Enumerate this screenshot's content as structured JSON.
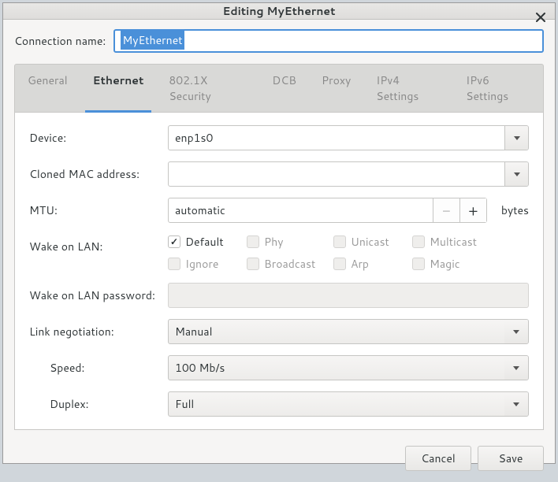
{
  "window": {
    "title": "Editing MyEthernet"
  },
  "connection": {
    "name_label": "Connection name:",
    "name_value": "MyEthernet"
  },
  "tabs": [
    {
      "label": "General"
    },
    {
      "label": "Ethernet"
    },
    {
      "label": "802.1X Security"
    },
    {
      "label": "DCB"
    },
    {
      "label": "Proxy"
    },
    {
      "label": "IPv4 Settings"
    },
    {
      "label": "IPv6 Settings"
    }
  ],
  "active_tab": 1,
  "ethernet": {
    "device_label": "Device:",
    "device_value": "enp1s0",
    "cloned_mac_label": "Cloned MAC address:",
    "cloned_mac_value": "",
    "mtu_label": "MTU:",
    "mtu_value": "automatic",
    "mtu_suffix": "bytes",
    "wol_label": "Wake on LAN:",
    "wol_options": [
      {
        "label": "Default",
        "checked": true,
        "enabled": true
      },
      {
        "label": "Phy",
        "checked": false,
        "enabled": false
      },
      {
        "label": "Unicast",
        "checked": false,
        "enabled": false
      },
      {
        "label": "Multicast",
        "checked": false,
        "enabled": false
      },
      {
        "label": "Ignore",
        "checked": false,
        "enabled": false
      },
      {
        "label": "Broadcast",
        "checked": false,
        "enabled": false
      },
      {
        "label": "Arp",
        "checked": false,
        "enabled": false
      },
      {
        "label": "Magic",
        "checked": false,
        "enabled": false
      }
    ],
    "wol_pw_label": "Wake on LAN password:",
    "link_neg_label": "Link negotiation:",
    "link_neg_value": "Manual",
    "speed_label": "Speed:",
    "speed_value": "100 Mb/s",
    "duplex_label": "Duplex:",
    "duplex_value": "Full"
  },
  "footer": {
    "cancel": "Cancel",
    "save": "Save"
  }
}
